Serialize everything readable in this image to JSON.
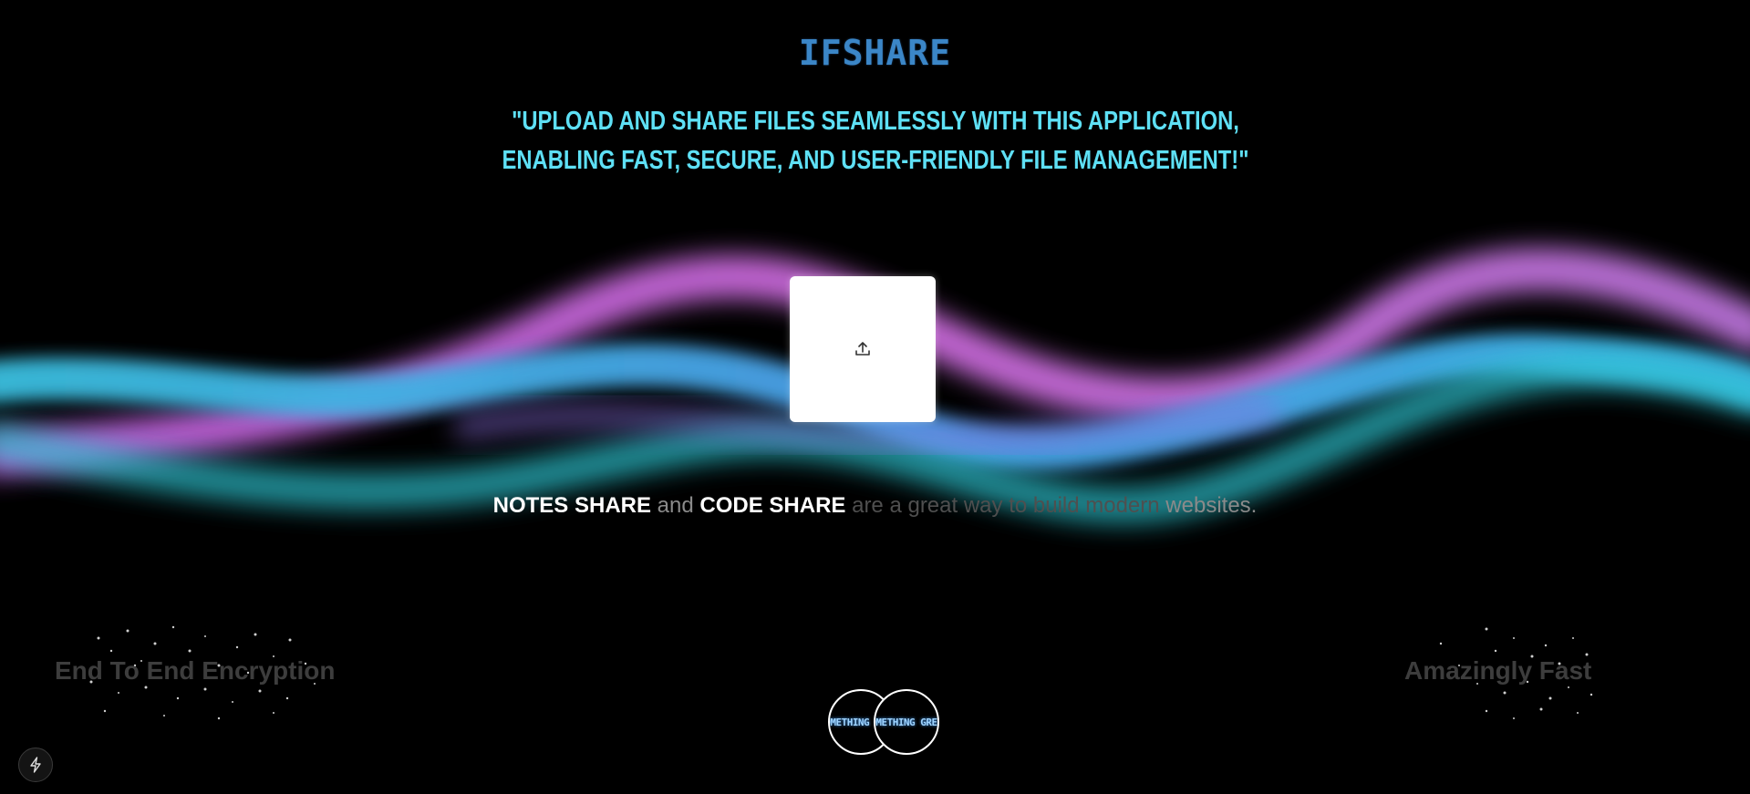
{
  "header": {
    "brand": "IFSHARE",
    "tagline": "\"Upload and share files seamlessly with this application, enabling fast, secure, and user-friendly file management!\""
  },
  "upload": {
    "icon": "upload-icon"
  },
  "subline": {
    "notes": "NOTES SHARE",
    "and": "and",
    "code": "CODE SHARE",
    "rest_light": "are a",
    "rest_dim": "great way to build modern",
    "rest_end": "websites."
  },
  "features": {
    "left": "End To End Encryption",
    "right": "Amazingly Fast"
  },
  "avatars": [
    {
      "label": "SOMETHING GREAT"
    },
    {
      "label": "SOMETHING GREAT"
    }
  ],
  "footer": {
    "icon": "bolt-icon"
  },
  "colors": {
    "background": "#000000",
    "tagline": "#5ee0f5",
    "brand": "#3b86c7",
    "wave_pink": "#d36ef0",
    "wave_cyan": "#3fc3ee"
  }
}
